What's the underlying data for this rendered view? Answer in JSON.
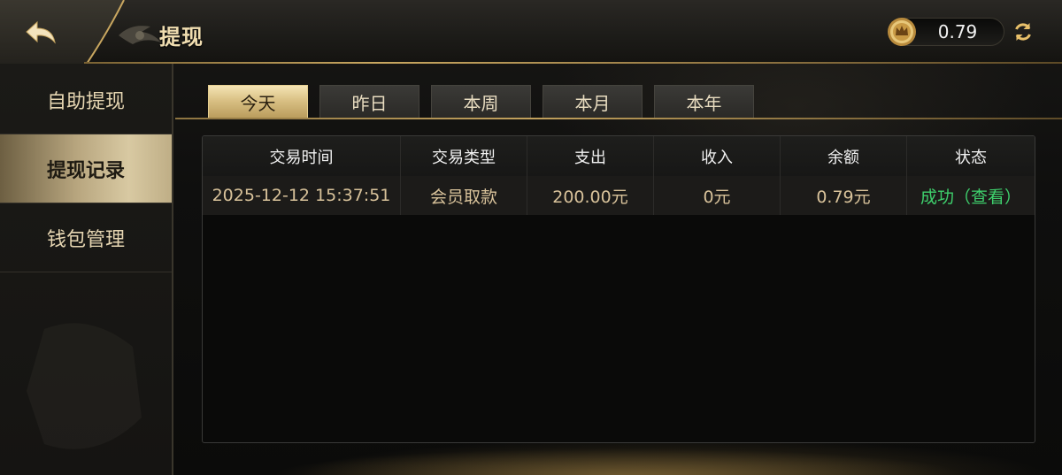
{
  "header": {
    "title": "提现",
    "balance": "0.79"
  },
  "sidebar": {
    "items": [
      {
        "label": "自助提现"
      },
      {
        "label": "提现记录"
      },
      {
        "label": "钱包管理"
      }
    ],
    "active_index": 1
  },
  "tabs": {
    "items": [
      {
        "label": "今天"
      },
      {
        "label": "昨日"
      },
      {
        "label": "本周"
      },
      {
        "label": "本月"
      },
      {
        "label": "本年"
      }
    ],
    "active_index": 0
  },
  "table": {
    "columns": [
      "交易时间",
      "交易类型",
      "支出",
      "收入",
      "余额",
      "状态"
    ],
    "rows": [
      [
        "2025-12-12 15:37:51",
        "会员取款",
        "200.00元",
        "0元",
        "0.79元",
        "成功（查看）"
      ]
    ]
  },
  "colors": {
    "accent_gold": "#c9a760",
    "status_success": "#3ecf6c"
  },
  "icons": {
    "back": "back-arrow-icon",
    "coin": "crown-coin-icon",
    "refresh": "refresh-icon"
  }
}
